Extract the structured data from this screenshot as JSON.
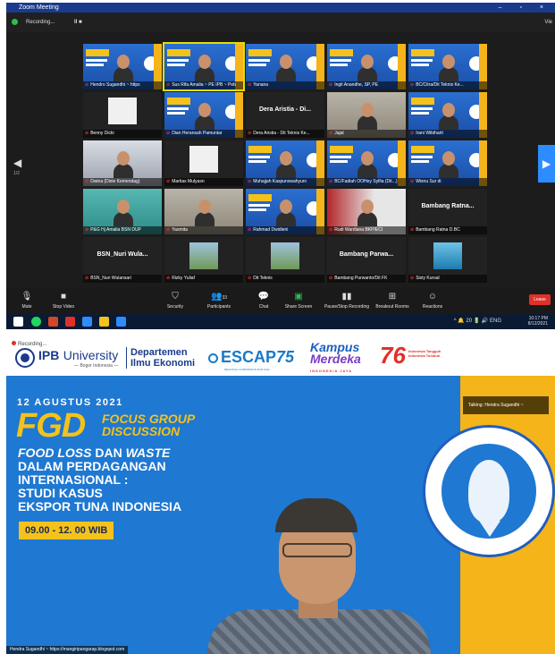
{
  "zoom": {
    "window_title": "Zoom Meeting",
    "window_controls": "– ▫ ×",
    "recording_label": "Recording...",
    "pause_stop": "II ■",
    "view_label": "Vie",
    "prev_page_arrow": "◀",
    "prev_page_num": "1/2",
    "next_page_arrow": "▶",
    "participants": [
      {
        "name": "Hendro Sugandhi ~ https",
        "kind": "banner-person"
      },
      {
        "name": "Sus Rifa Amalia ~ PE IPB ~ Peb",
        "kind": "banner-person",
        "active": true
      },
      {
        "name": "Yanana",
        "kind": "banner-person"
      },
      {
        "name": "Ingit Anandhe, SP, PE",
        "kind": "banner-person"
      },
      {
        "name": "BC/Citra/Dit Teknis Ke...",
        "kind": "banner-person"
      },
      {
        "name": "Benny Dicki",
        "kind": "pic"
      },
      {
        "name": "Dian Heransah Pamuntar",
        "kind": "banner-person"
      },
      {
        "name": "Dera Aristia - Dit Teknis Ke...",
        "kind": "label",
        "label": "Dera Aristia - Di..."
      },
      {
        "name": "Jajat",
        "kind": "room"
      },
      {
        "name": "Irani Wibiharti",
        "kind": "banner-person"
      },
      {
        "name": "Dwina (Dixie Kemendag)",
        "kind": "mosque"
      },
      {
        "name": "Martias Mulyasn",
        "kind": "pic"
      },
      {
        "name": "Muhajjah Kaspunswahyuni",
        "kind": "banner-person"
      },
      {
        "name": "BC/Fadiah OOHey Sylfia (Dit...)",
        "kind": "banner-person"
      },
      {
        "name": "Wisnu Sur di",
        "kind": "banner-person"
      },
      {
        "name": "P&G Hj Amalia BSN DUP",
        "kind": "teal"
      },
      {
        "name": "Yasmita",
        "kind": "room"
      },
      {
        "name": "Rahmad Dwidieni",
        "kind": "banner-person"
      },
      {
        "name": "Rudi Wardiana BKP/ECI",
        "kind": "redwall"
      },
      {
        "name": "Bambang Ratna D.BC",
        "kind": "label",
        "label": "Bambang Ratna..."
      },
      {
        "name": "BSN_Nuri Wulansari",
        "kind": "label",
        "label": "BSN_Nuri Wula..."
      },
      {
        "name": "Rizky Yuliaf",
        "kind": "pic-green"
      },
      {
        "name": "Dit Teknis",
        "kind": "pic-green"
      },
      {
        "name": "Bambang Purwanto/Dit FK",
        "kind": "label",
        "label": "Bambang Parwa..."
      },
      {
        "name": "Sisty Kursal",
        "kind": "pic-sea"
      }
    ],
    "toolbar": {
      "mute": "Mute",
      "stop_video": "Stop Video",
      "security": "Security",
      "participants": "Participants",
      "participants_count": "33",
      "chat": "Chat",
      "share_screen": "Share Screen",
      "recording": "Pause/Stop Recording",
      "breakout": "Breakout Rooms",
      "reactions": "Reactions",
      "leave": "Leave"
    },
    "taskbar": {
      "time": "10:17 PM",
      "date": "8/12/2021",
      "tray": "^ 🔔 20 🔋 🔊 ENG"
    }
  },
  "slide": {
    "recording_badge": "Recording...",
    "ipb_name_a": "IPB",
    "ipb_name_b": "University",
    "ipb_sub": "— Bogor Indonesia —",
    "department": "Departemen Ilmu Ekonomi",
    "escap": "ESCAP",
    "escap_75": "75",
    "escap_sub": "REGIONAL COMMISSION FOR ASIA",
    "kampus": "Kampus",
    "merdeka": "Merdeka",
    "kampus_sub": "INDONESIA JAYA",
    "ri76": "76",
    "ri76_text": "Indonesia Tangguh Indonesia Tumbuh",
    "talking_label": "Talking: Hendra Sugandhi ~",
    "date": "12 AGUSTUS 2021",
    "fgd": "FGD",
    "fgd_sub1": "FOCUS GROUP",
    "fgd_sub2": "DISCUSSION",
    "topic_line1_a": "FOOD LOSS",
    "topic_line1_b": " DAN ",
    "topic_line1_c": "WASTE",
    "topic_line2": "DALAM PERDAGANGAN",
    "topic_line3": "INTERNASIONAL :",
    "topic_line4": "STUDI KASUS",
    "topic_line5": "EKSPOR TUNA INDONESIA",
    "time": "09.00 - 12. 00 WIB",
    "speaker_name": "Hendra Sugandhi ~ https://mangiripangarap.blogspot.com"
  }
}
